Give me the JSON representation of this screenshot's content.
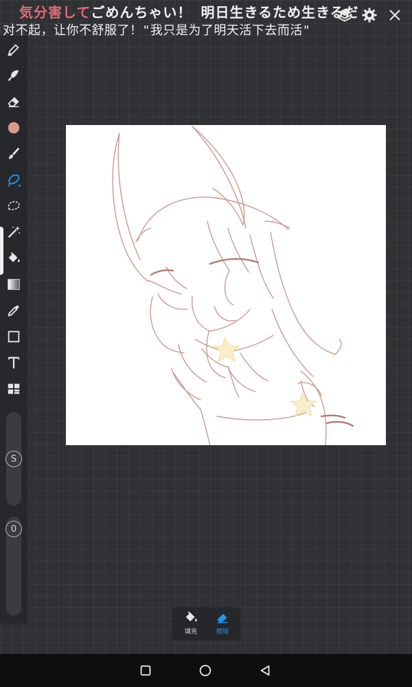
{
  "caption": {
    "line1_red": "気分害して",
    "line1_white": "ごめんちゃい！ 明日生きるため生きるだ",
    "line2": "对不起，让你不舒服了！\"我只是为了明天活下去而活\""
  },
  "bottom_panel": {
    "fill_label": "填充",
    "erase_label": "擦除"
  },
  "sliders": {
    "size_marker": "S",
    "opacity_marker": "0"
  },
  "colors": {
    "accent": "#2196f3",
    "current_color": "#d8998a",
    "sketch_stroke": "#c99a90"
  }
}
